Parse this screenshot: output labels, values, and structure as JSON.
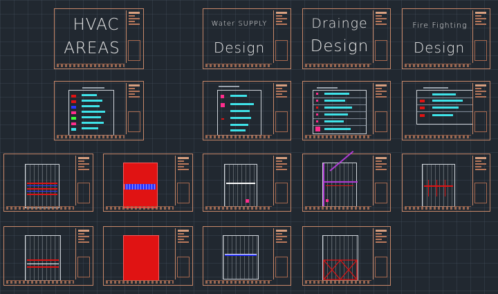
{
  "colors": {
    "background": "#212830",
    "sheet_border": "#c9896a",
    "title_text": "#e8e8e8",
    "legend_text": "#3fe3e9",
    "red_fill": "#e01313",
    "blue_pipe": "#2a35ff",
    "pink": "#ff2d8c"
  },
  "cover_sheets": {
    "hvac": {
      "line1": "HVAC",
      "line2": "AREAS"
    },
    "water": {
      "line1": "Water SUPPLY",
      "line2": "Design"
    },
    "drainage": {
      "line1": "Drainge",
      "line2": "Design"
    },
    "fire": {
      "line1": "Fire Fighting",
      "line2": "Design"
    }
  },
  "legend_sheets": [
    "hvac-legend",
    "water-legend",
    "drainage-legend",
    "fire-legend"
  ],
  "plan_sheets": [
    "hvac-plan-1",
    "hvac-plan-2",
    "water-plan-1",
    "drainage-plan-1",
    "fire-plan-1",
    "hvac-plan-3",
    "hvac-plan-4",
    "water-plan-2",
    "drainage-plan-2"
  ]
}
